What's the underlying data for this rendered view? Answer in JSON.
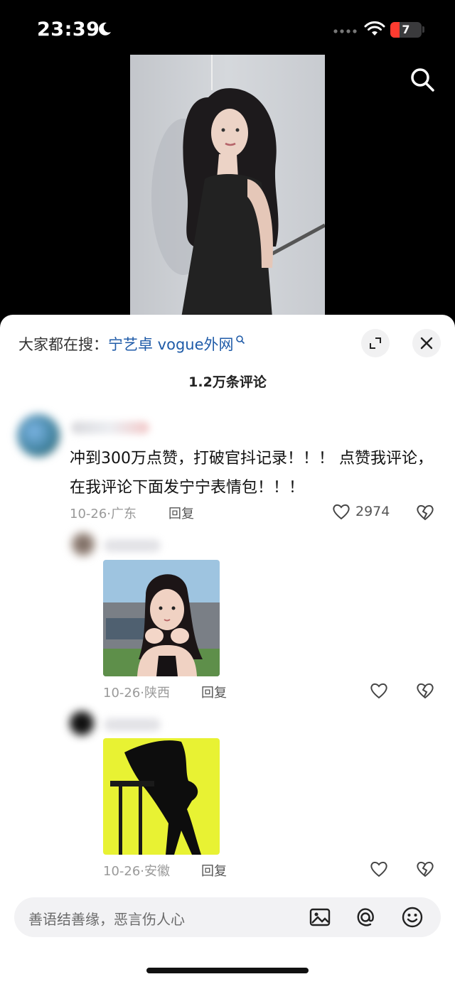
{
  "status": {
    "time": "23:39",
    "battery": "7",
    "battery_level": 0.07
  },
  "icons": {
    "search": "search-icon",
    "moon": "moon-icon",
    "wifi": "wifi-icon",
    "expand": "expand-icon",
    "close": "close-icon",
    "heart": "heart-icon",
    "dislike": "broken-heart-icon",
    "image": "image-icon",
    "at": "at-sign-icon",
    "emoji": "emoji-icon"
  },
  "sheet": {
    "search_prefix": "大家都在搜：",
    "search_term": "宁艺卓 vogue外网",
    "comment_count": "1.2万条评论"
  },
  "comments": [
    {
      "text": "冲到300万点赞，打破官抖记录！！！ 点赞我评论，在我评论下面发宁宁表情包！！！",
      "meta": "10-26·广东",
      "reply": "回复",
      "likes": "2974"
    },
    {
      "meta": "10-26·陕西",
      "reply": "回复"
    },
    {
      "meta": "10-26·安徽",
      "reply": "回复"
    }
  ],
  "input": {
    "placeholder": "善语结善缘，恶言伤人心"
  },
  "colors": {
    "accent_link": "#1f5ba8",
    "sticker_bg": "#e8f233"
  }
}
